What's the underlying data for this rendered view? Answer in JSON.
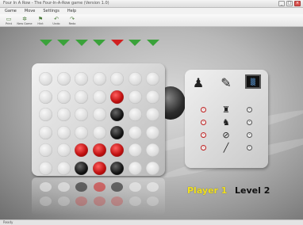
{
  "window": {
    "title": "Four In A Row - The Four-In-A-Row game (Version 1.0)",
    "controls": [
      "_",
      "□",
      "×"
    ]
  },
  "menu": {
    "items": [
      "Game",
      "Move",
      "Settings",
      "Help"
    ]
  },
  "toolbar": {
    "buttons": [
      {
        "label": "Print",
        "icon": "print-icon"
      },
      {
        "label": "New Game",
        "icon": "new-game-icon"
      },
      {
        "label": "Hint",
        "icon": "hint-icon"
      },
      {
        "label": "Undo",
        "icon": "undo-icon"
      },
      {
        "label": "Redo",
        "icon": "redo-icon"
      }
    ]
  },
  "board": {
    "columns": 7,
    "rows": 6,
    "drop_arrows": [
      "green",
      "green",
      "green",
      "green",
      "red",
      "green",
      "green"
    ],
    "cells": [
      [
        "empty",
        "empty",
        "empty",
        "empty",
        "empty",
        "empty",
        "empty"
      ],
      [
        "empty",
        "empty",
        "empty",
        "empty",
        "red",
        "empty",
        "empty"
      ],
      [
        "empty",
        "empty",
        "empty",
        "empty",
        "black",
        "empty",
        "empty"
      ],
      [
        "empty",
        "empty",
        "empty",
        "empty",
        "black",
        "empty",
        "empty"
      ],
      [
        "empty",
        "empty",
        "red",
        "red",
        "red",
        "empty",
        "empty"
      ],
      [
        "empty",
        "empty",
        "black",
        "red",
        "black",
        "empty",
        "empty"
      ]
    ],
    "colors": {
      "red": "#c01010",
      "black": "#111111",
      "arrow_green": "#3aa23a",
      "arrow_red": "#d02020"
    }
  },
  "panel": {
    "icons": [
      "player-computer-icon",
      "notepad-pencil-icon",
      "monitor-icon"
    ],
    "settings": [
      {
        "glyph": "♜"
      },
      {
        "glyph": "♞"
      },
      {
        "glyph": "⊘"
      },
      {
        "glyph": "╱"
      }
    ]
  },
  "status": {
    "player": "Player 1",
    "level": "Level 2",
    "player_color": "#f0e020"
  },
  "statusbar": {
    "text": "Ready"
  }
}
